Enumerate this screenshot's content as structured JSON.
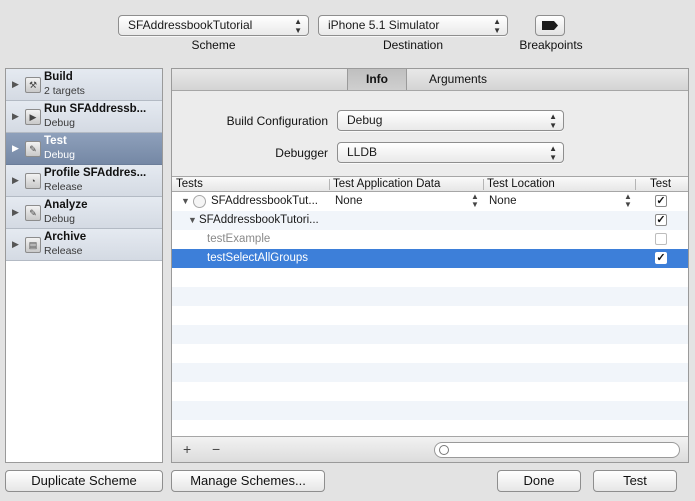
{
  "toolbar": {
    "scheme_value": "SFAddressbookTutorial",
    "scheme_caption": "Scheme",
    "destination_value": "iPhone 5.1 Simulator",
    "destination_caption": "Destination",
    "breakpoints_caption": "Breakpoints",
    "breakpoints_icon": "breakpoint-arrow-icon"
  },
  "sidebar": {
    "items": [
      {
        "label": "Build",
        "sub": "2 targets",
        "icon": "hammer-icon",
        "selected": false
      },
      {
        "label": "Run SFAddressb...",
        "sub": "Debug",
        "icon": "play-icon",
        "selected": false
      },
      {
        "label": "Test",
        "sub": "Debug",
        "icon": "wrench-icon",
        "selected": true
      },
      {
        "label": "Profile SFAddres...",
        "sub": "Release",
        "icon": "gauge-icon",
        "selected": false
      },
      {
        "label": "Analyze",
        "sub": "Debug",
        "icon": "wrench-icon",
        "selected": false
      },
      {
        "label": "Archive",
        "sub": "Release",
        "icon": "box-icon",
        "selected": false
      }
    ]
  },
  "tabs": [
    {
      "label": "Info",
      "active": true
    },
    {
      "label": "Arguments",
      "active": false
    }
  ],
  "form": {
    "build_config_label": "Build Configuration",
    "build_config_value": "Debug",
    "debugger_label": "Debugger",
    "debugger_value": "LLDB"
  },
  "table": {
    "headers": [
      "Tests",
      "Test Application Data",
      "Test Location",
      "Test"
    ],
    "rows": [
      {
        "name": "SFAddressbookTut...",
        "app_data": "None",
        "location": "None",
        "checked": true,
        "level": 0
      },
      {
        "name": "SFAddressbookTutori...",
        "app_data": "",
        "location": "",
        "checked": true,
        "level": 1
      },
      {
        "name": "testExample",
        "app_data": "",
        "location": "",
        "checked": false,
        "level": 2
      },
      {
        "name": "testSelectAllGroups",
        "app_data": "",
        "location": "",
        "checked": true,
        "level": 2,
        "selected": true
      }
    ],
    "add_label": "+",
    "remove_label": "−",
    "check_mark": "✓"
  },
  "buttons": {
    "duplicate": "Duplicate Scheme",
    "manage": "Manage Schemes...",
    "done": "Done",
    "test": "Test"
  },
  "glyphs": {
    "updown": "▲\n▼",
    "disclosure_right": "▶",
    "disclosure_down": "▼"
  },
  "colors": {
    "selection": "#3d7fd9",
    "sidebar_selected": "#7d8fab"
  }
}
